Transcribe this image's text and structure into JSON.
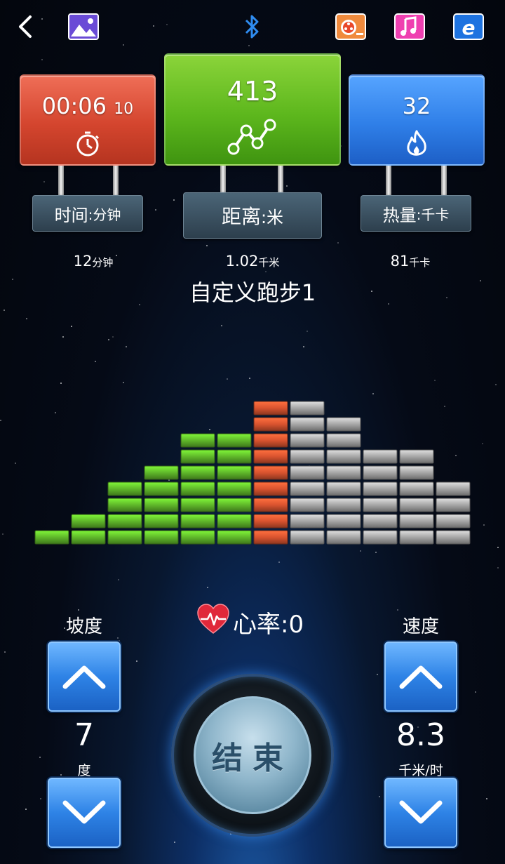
{
  "topbar": {
    "icons": [
      "back-icon",
      "gallery-icon",
      "bluetooth-icon",
      "video-icon",
      "music-icon",
      "browser-icon"
    ]
  },
  "time_panel": {
    "value": "00:06",
    "sub_value": "10",
    "label": "时间",
    "label_unit": ":分钟",
    "target": "12",
    "target_unit": "分钟",
    "color": "#d4452e"
  },
  "distance_panel": {
    "value": "413",
    "label": "距离",
    "label_unit": ":米",
    "target": "1.02",
    "target_unit": "千米",
    "color": "#5db71d"
  },
  "calorie_panel": {
    "value": "32",
    "label": "热量",
    "label_unit": ":千卡",
    "target": "81",
    "target_unit": "千卡",
    "color": "#2f7fe8"
  },
  "program": {
    "title": "自定义跑步1"
  },
  "chart_data": {
    "type": "bar",
    "categories": [
      "1",
      "2",
      "3",
      "4",
      "5",
      "6",
      "7",
      "8",
      "9",
      "10",
      "11",
      "12"
    ],
    "values": [
      1,
      2,
      4,
      5,
      7,
      7,
      9,
      9,
      8,
      6,
      6,
      4
    ],
    "current_index": 6,
    "colors": {
      "done": "#5fb72a",
      "current": "#d9532f",
      "pending": "#a6a6a6"
    }
  },
  "heart_rate": {
    "label": "心率:0"
  },
  "incline": {
    "title": "坡度",
    "value": "7",
    "unit": "度"
  },
  "speed": {
    "title": "速度",
    "value": "8.3",
    "unit": "千米/时"
  },
  "end_button": {
    "label": "结束"
  }
}
